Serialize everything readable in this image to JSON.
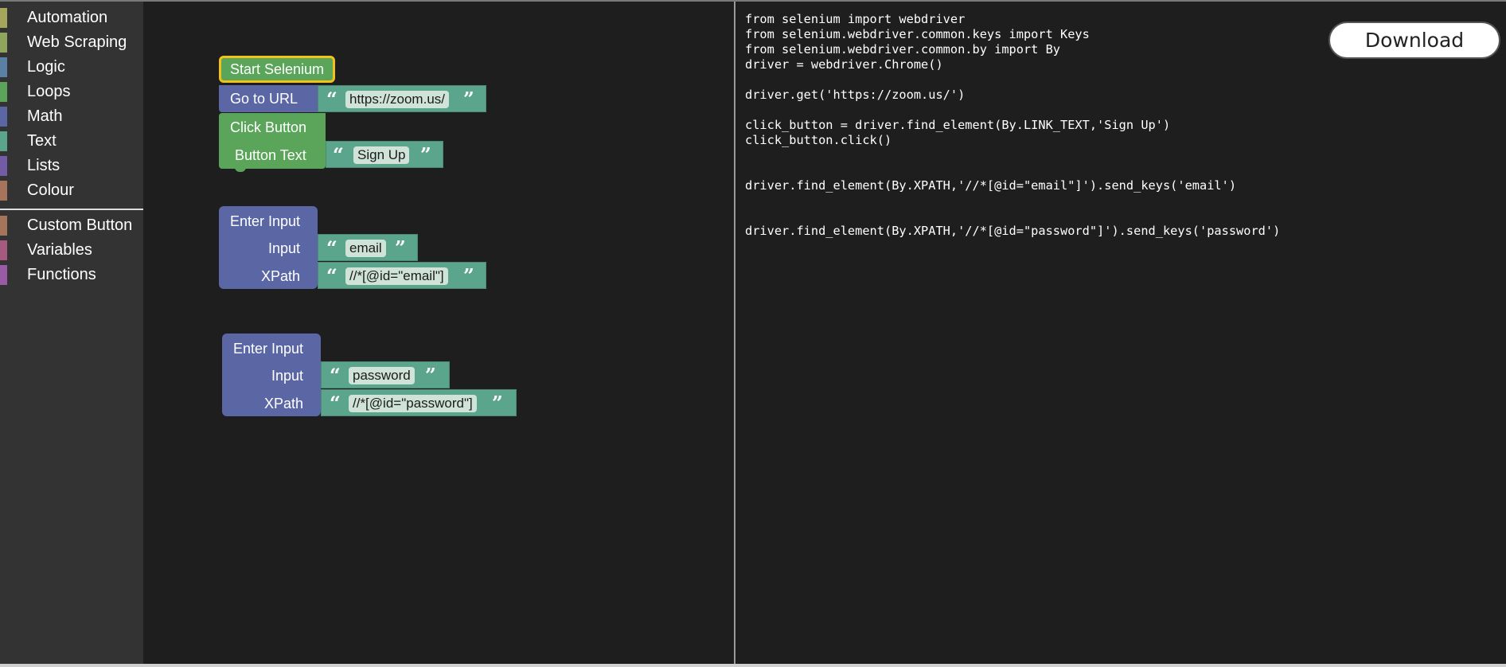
{
  "toolbox": {
    "categories": [
      {
        "label": "Automation",
        "color": "#a5a55b"
      },
      {
        "label": "Web Scraping",
        "color": "#8fa55b"
      },
      {
        "label": "Logic",
        "color": "#5b80a5"
      },
      {
        "label": "Loops",
        "color": "#5ba55b"
      },
      {
        "label": "Math",
        "color": "#5b67a5"
      },
      {
        "label": "Text",
        "color": "#5ba58c"
      },
      {
        "label": "Lists",
        "color": "#745ba5"
      },
      {
        "label": "Colour",
        "color": "#a5745b"
      }
    ],
    "custom": [
      {
        "label": "Custom Button",
        "color": "#a5745b"
      },
      {
        "label": "Variables",
        "color": "#a55b80"
      },
      {
        "label": "Functions",
        "color": "#995ba5"
      }
    ]
  },
  "blocks": {
    "start": {
      "label": "Start Selenium"
    },
    "goto": {
      "label": "Go to URL",
      "value": "https://zoom.us/"
    },
    "click": {
      "label": "Click Button",
      "text_label": "Button Text",
      "value": "Sign Up"
    },
    "input1": {
      "label": "Enter Input",
      "input_label": "Input",
      "input_value": "email",
      "xpath_label": "XPath",
      "xpath_value": "//*[@id=\"email\"]"
    },
    "input2": {
      "label": "Enter Input",
      "input_label": "Input",
      "input_value": "password",
      "xpath_label": "XPath",
      "xpath_value": "//*[@id=\"password\"]"
    },
    "quote_open": "“",
    "quote_close": "”"
  },
  "code": {
    "text": "from selenium import webdriver\nfrom selenium.webdriver.common.keys import Keys\nfrom selenium.webdriver.common.by import By\ndriver = webdriver.Chrome()\n\ndriver.get('https://zoom.us/')\n\nclick_button = driver.find_element(By.LINK_TEXT,'Sign Up')\nclick_button.click()\n\n\ndriver.find_element(By.XPATH,'//*[@id=\"email\"]').send_keys('email')\n\n\ndriver.find_element(By.XPATH,'//*[@id=\"password\"]').send_keys('password')"
  },
  "download_label": "Download",
  "workspace": {
    "trash_icon": "trash-can-icon"
  }
}
